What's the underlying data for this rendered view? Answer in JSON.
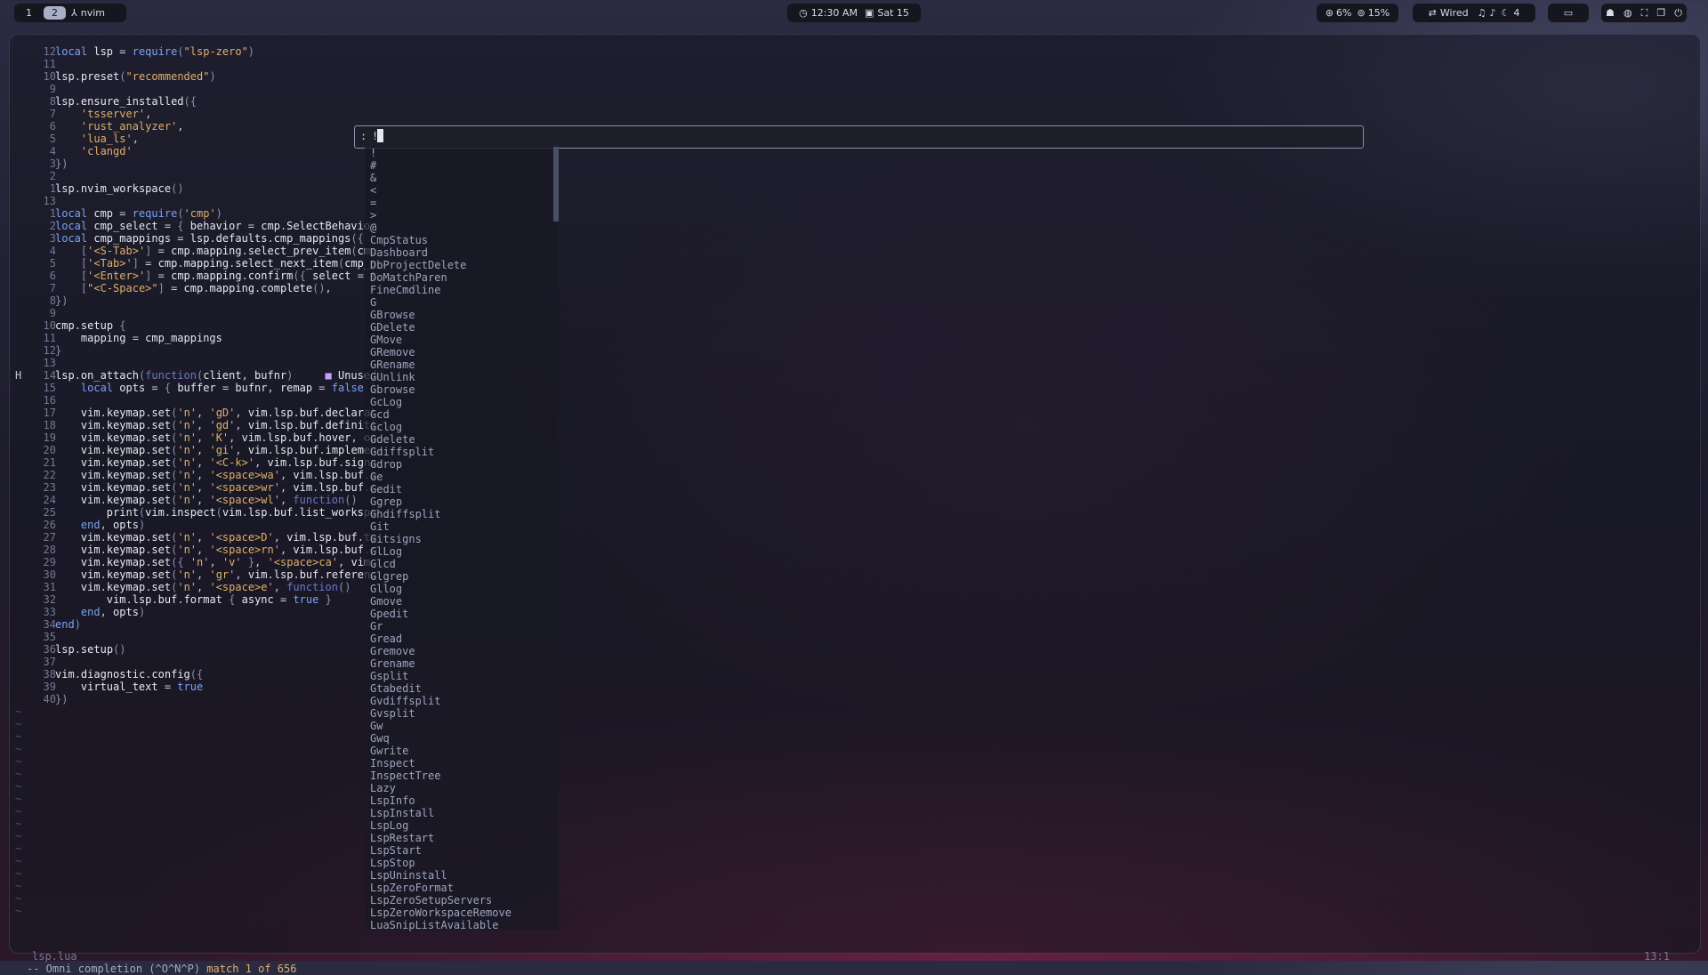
{
  "topbar": {
    "workspaces": [
      "1",
      "2"
    ],
    "active_workspace": "2",
    "window_title": "nvim",
    "time": "12:30 AM",
    "date": "Sat 15",
    "cpu": "6%",
    "memory": "15%",
    "network": "Wired",
    "volume": "4"
  },
  "cmdline": {
    "prompt": ":",
    "text": "!"
  },
  "editor": {
    "lines": [
      {
        "n": "12",
        "t": "local lsp = require(\"lsp-zero\")"
      },
      {
        "n": "11",
        "t": ""
      },
      {
        "n": "10",
        "t": "lsp.preset(\"recommended\")"
      },
      {
        "n": "9",
        "t": ""
      },
      {
        "n": "8",
        "t": "lsp.ensure_installed({"
      },
      {
        "n": "7",
        "t": "    'tsserver',"
      },
      {
        "n": "6",
        "t": "    'rust_analyzer',"
      },
      {
        "n": "5",
        "t": "    'lua_ls',"
      },
      {
        "n": "4",
        "t": "    'clangd'"
      },
      {
        "n": "3",
        "t": "})"
      },
      {
        "n": "2",
        "t": ""
      },
      {
        "n": "1",
        "t": "lsp.nvim_workspace()"
      },
      {
        "n": "13",
        "t": ""
      },
      {
        "n": "1",
        "t": "local cmp = require('cmp')"
      },
      {
        "n": "2",
        "t": "local cmp_select = { behavior = cmp.SelectBehavior"
      },
      {
        "n": "3",
        "t": "local cmp_mappings = lsp.defaults.cmp_mappings({"
      },
      {
        "n": "4",
        "t": "    ['<S-Tab>'] = cmp.mapping.select_prev_item(cmp"
      },
      {
        "n": "5",
        "t": "    ['<Tab>'] = cmp.mapping.select_next_item(cmp_s"
      },
      {
        "n": "6",
        "t": "    ['<Enter>'] = cmp.mapping.confirm({ select = t"
      },
      {
        "n": "7",
        "t": "    [\"<C-Space>\"] = cmp.mapping.complete(),"
      },
      {
        "n": "8",
        "t": "})"
      },
      {
        "n": "9",
        "t": ""
      },
      {
        "n": "10",
        "t": "cmp.setup {"
      },
      {
        "n": "11",
        "t": "    mapping = cmp_mappings"
      },
      {
        "n": "12",
        "t": "}"
      },
      {
        "n": "13",
        "t": ""
      },
      {
        "n": "14",
        "t": "lsp.on_attach(function(client, bufnr)     ■ Unused",
        "s": "H"
      },
      {
        "n": "15",
        "t": "    local opts = { buffer = bufnr, remap = false }"
      },
      {
        "n": "16",
        "t": ""
      },
      {
        "n": "17",
        "t": "    vim.keymap.set('n', 'gD', vim.lsp.buf.declarat"
      },
      {
        "n": "18",
        "t": "    vim.keymap.set('n', 'gd', vim.lsp.buf.definiti"
      },
      {
        "n": "19",
        "t": "    vim.keymap.set('n', 'K', vim.lsp.buf.hover, op"
      },
      {
        "n": "20",
        "t": "    vim.keymap.set('n', 'gi', vim.lsp.buf.implemen"
      },
      {
        "n": "21",
        "t": "    vim.keymap.set('n', '<C-k>', vim.lsp.buf.signa"
      },
      {
        "n": "22",
        "t": "    vim.keymap.set('n', '<space>wa', vim.lsp.buf.a"
      },
      {
        "n": "23",
        "t": "    vim.keymap.set('n', '<space>wr', vim.lsp.buf.r"
      },
      {
        "n": "24",
        "t": "    vim.keymap.set('n', '<space>wl', function()"
      },
      {
        "n": "25",
        "t": "        print(vim.inspect(vim.lsp.buf.list_workspa"
      },
      {
        "n": "26",
        "t": "    end, opts)"
      },
      {
        "n": "27",
        "t": "    vim.keymap.set('n', '<space>D', vim.lsp.buf.ty"
      },
      {
        "n": "28",
        "t": "    vim.keymap.set('n', '<space>rn', vim.lsp.buf.r"
      },
      {
        "n": "29",
        "t": "    vim.keymap.set({ 'n', 'v' }, '<space>ca', vim."
      },
      {
        "n": "30",
        "t": "    vim.keymap.set('n', 'gr', vim.lsp.buf.referenc"
      },
      {
        "n": "31",
        "t": "    vim.keymap.set('n', '<space>e', function()"
      },
      {
        "n": "32",
        "t": "        vim.lsp.buf.format { async = true }"
      },
      {
        "n": "33",
        "t": "    end, opts)"
      },
      {
        "n": "34",
        "t": "end)"
      },
      {
        "n": "35",
        "t": ""
      },
      {
        "n": "36",
        "t": "lsp.setup()"
      },
      {
        "n": "37",
        "t": ""
      },
      {
        "n": "38",
        "t": "vim.diagnostic.config({"
      },
      {
        "n": "39",
        "t": "    virtual_text = true"
      },
      {
        "n": "40",
        "t": "})"
      }
    ],
    "tilde": "~",
    "tilde_count": 17
  },
  "completion": {
    "items": [
      "!",
      "#",
      "&",
      "<",
      "=",
      ">",
      "@",
      "CmpStatus",
      "Dashboard",
      "DbProjectDelete",
      "DoMatchParen",
      "FineCmdline",
      "G",
      "GBrowse",
      "GDelete",
      "GMove",
      "GRemove",
      "GRename",
      "GUnlink",
      "Gbrowse",
      "GcLog",
      "Gcd",
      "Gclog",
      "Gdelete",
      "Gdiffsplit",
      "Gdrop",
      "Ge",
      "Gedit",
      "Ggrep",
      "Ghdiffsplit",
      "Git",
      "Gitsigns",
      "GlLog",
      "Glcd",
      "Glgrep",
      "Gllog",
      "Gmove",
      "Gpedit",
      "Gr",
      "Gread",
      "Gremove",
      "Grename",
      "Gsplit",
      "Gtabedit",
      "Gvdiffsplit",
      "Gvsplit",
      "Gw",
      "Gwq",
      "Gwrite",
      "Inspect",
      "InspectTree",
      "Lazy",
      "LspInfo",
      "LspInstall",
      "LspLog",
      "LspRestart",
      "LspStart",
      "LspStop",
      "LspUninstall",
      "LspZeroFormat",
      "LspZeroSetupServers",
      "LspZeroWorkspaceRemove",
      "LuaSnipListAvailable"
    ]
  },
  "statusline": {
    "filename": "lsp.lua",
    "position": "13:1"
  },
  "message": {
    "prefix": "-- Omni completion (^O^N^P) ",
    "match": "match 1 of 656"
  },
  "colors": {
    "keyword": "#7aa2f7",
    "string": "#e0af68",
    "identifier": "#c0caf5",
    "ident_main": "#e6e8f0",
    "func": "#7dcfff",
    "paren": "#8a90b0",
    "line_number": "#737a96",
    "function_kw": "#6a78c8",
    "unused_bullet": "#c0a0ff",
    "match_text": "#e0af68"
  }
}
